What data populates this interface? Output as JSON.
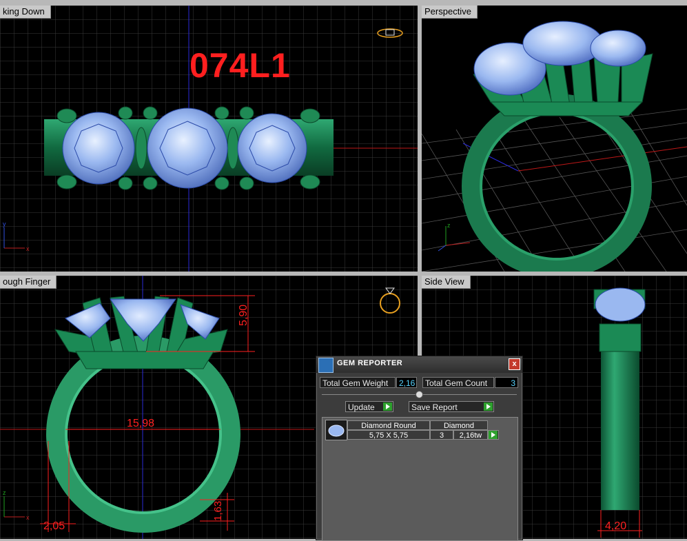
{
  "viewports": {
    "top": {
      "title": "king Down",
      "stamp": "074L1"
    },
    "perspective": {
      "title": "Perspective"
    },
    "front": {
      "title": "ough Finger",
      "dim_height": "5,90",
      "dim_width": "15,98",
      "dim_bottom": "2,05",
      "dim_band": "1,63"
    },
    "side": {
      "title": "Side View",
      "dim_width": "4,20"
    }
  },
  "axes": {
    "x": "x",
    "y": "y",
    "z": "z"
  },
  "gem_reporter": {
    "title": "GEM REPORTER",
    "close": "x",
    "total_weight_label": "Total Gem Weight",
    "total_weight_value": "2,16",
    "total_count_label": "Total Gem Count",
    "total_count_value": "3",
    "update_label": "Update",
    "save_label": "Save Report",
    "row": {
      "shape": "Diamond Round",
      "size": "5,75 X 5,75",
      "material": "Diamond",
      "count": "3",
      "weight": "2,16tw"
    }
  },
  "colors": {
    "metal": "#1b7a4e",
    "gem": "#9ab8f0",
    "dimension": "#ff2020",
    "grid": "#3a3a3a",
    "stamp": "#ff1f1f"
  }
}
